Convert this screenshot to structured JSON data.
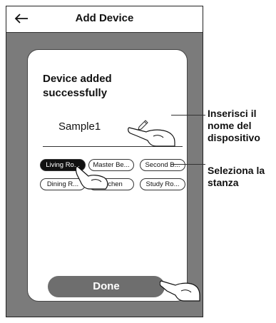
{
  "header": {
    "title": "Add Device"
  },
  "card": {
    "headline": "Device added\nsuccessfully",
    "device_name": "Sample1",
    "rooms": [
      {
        "label": "Living Ro...",
        "selected": true
      },
      {
        "label": "Master Be...",
        "selected": false
      },
      {
        "label": "Second B...",
        "selected": false
      },
      {
        "label": "Dining R...",
        "selected": false
      },
      {
        "label": "Kitchen",
        "selected": false
      },
      {
        "label": "Study Ro...",
        "selected": false
      }
    ],
    "done_label": "Done"
  },
  "annotations": {
    "name": "Inserisci il\nnome del\ndispositivo",
    "room": "Seleziona la\nstanza"
  }
}
